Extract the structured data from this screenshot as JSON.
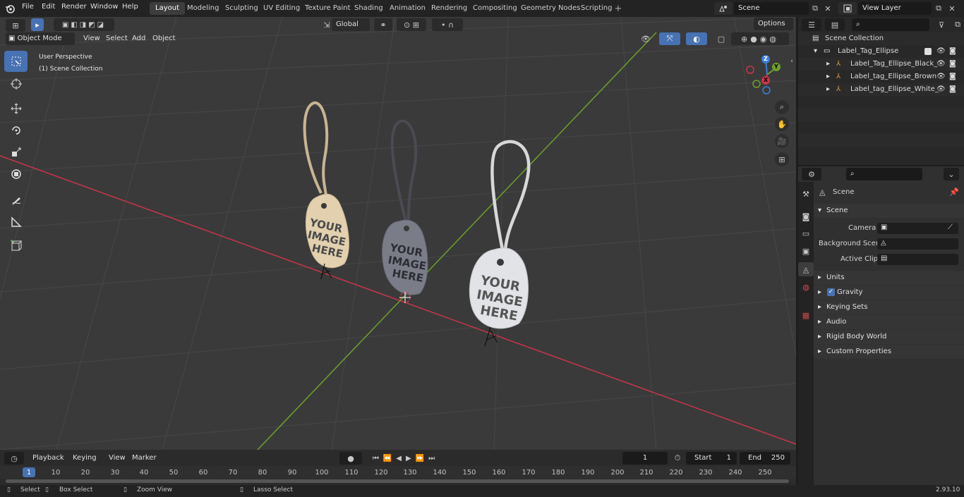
{
  "menu": [
    "File",
    "Edit",
    "Render",
    "Window",
    "Help"
  ],
  "workspaces": [
    "Layout",
    "Modeling",
    "Sculpting",
    "UV Editing",
    "Texture Paint",
    "Shading",
    "Animation",
    "Rendering",
    "Compositing",
    "Geometry Nodes",
    "Scripting"
  ],
  "active_workspace": "Layout",
  "scene_field": "Scene",
  "view_layer_field": "View Layer",
  "transform": {
    "orientation": "Global"
  },
  "options_label": "Options",
  "viewport_header": {
    "mode": "Object Mode",
    "view": "View",
    "select": "Select",
    "add": "Add",
    "object": "Object"
  },
  "overlay": {
    "line1": "User Perspective",
    "line2": "(1) Scene Collection"
  },
  "gizmo": {
    "z": "Z",
    "y": "Y",
    "x": "X"
  },
  "tag_text": [
    "YOUR",
    "IMAGE",
    "HERE"
  ],
  "outliner": {
    "root": "Scene Collection",
    "collection": "Label_Tag_Ellipse",
    "objects": [
      "Label_Tag_Ellipse_Black_",
      "Label_tag_Ellipse_Brown",
      "Label_tag_Ellipse_White_"
    ]
  },
  "properties": {
    "context": "Scene",
    "panel": "Scene",
    "camera_label": "Camera",
    "background_label": "Background Scene",
    "clip_label": "Active Clip",
    "subpanels": [
      "Units",
      "Gravity",
      "Keying Sets",
      "Audio",
      "Rigid Body World",
      "Custom Properties"
    ]
  },
  "timeline": {
    "playback": "Playback",
    "keying": "Keying",
    "view": "View",
    "marker": "Marker",
    "current_frame": "1",
    "start_label": "Start",
    "start": "1",
    "end_label": "End",
    "end": "250",
    "ticks": [
      "1",
      "10",
      "20",
      "30",
      "40",
      "50",
      "60",
      "70",
      "80",
      "90",
      "100",
      "110",
      "120",
      "130",
      "140",
      "150",
      "160",
      "170",
      "180",
      "190",
      "200",
      "210",
      "220",
      "230",
      "240",
      "250"
    ]
  },
  "status": {
    "select": "Select",
    "box_select": "Box Select",
    "zoom_view": "Zoom View",
    "lasso_select": "Lasso Select",
    "version": "2.93.10"
  },
  "colors": {
    "accent": "#4772b3",
    "x_axis": "#c8354a",
    "y_axis": "#6ea02a",
    "z_axis": "#3b7fd9"
  }
}
